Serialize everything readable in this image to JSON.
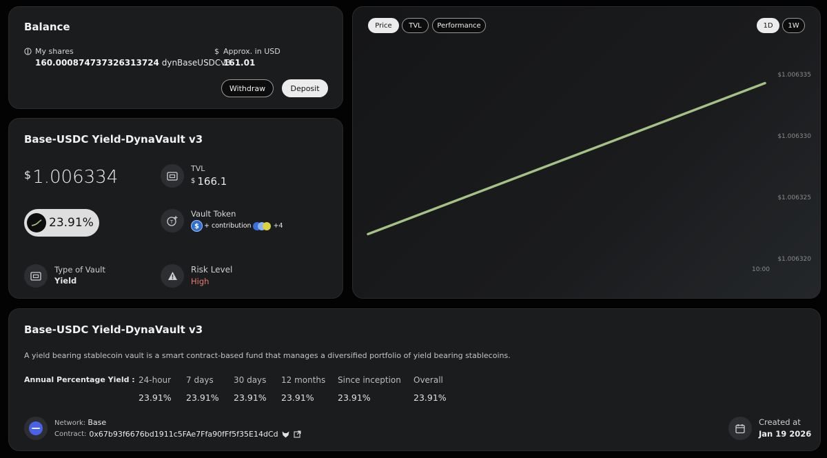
{
  "balance": {
    "title": "Balance",
    "shares_label": "My shares",
    "shares_value": "160.000874737326313724",
    "shares_token": "dynBaseUSDCv3",
    "usd_symbol": "$",
    "usd_label": "Approx. in USD",
    "usd_value": "161.01",
    "withdraw_label": "Withdraw",
    "deposit_label": "Deposit"
  },
  "vault": {
    "title": "Base-USDC Yield-DynaVault v3",
    "price_symbol": "$",
    "price_value": "1.006334",
    "apy_badge": "23.91%",
    "tvl_label": "TVL",
    "tvl_symbol": "$",
    "tvl_value": "166.1",
    "vault_token_label": "Vault Token",
    "vault_token_text": "+ contribution",
    "vault_token_more": "+4",
    "type_label": "Type of Vault",
    "type_value": "Yield",
    "risk_label": "Risk Level",
    "risk_value": "High"
  },
  "chart_tabs": {
    "price": "Price",
    "tvl": "TVL",
    "performance": "Performance",
    "range_1d": "1D",
    "range_1w": "1W"
  },
  "chart_data": {
    "type": "line",
    "x": [
      "",
      "10:00"
    ],
    "series": [
      {
        "values": [
          1.006322,
          1.0063343
        ]
      }
    ],
    "y_ticks": [
      "$1.006335",
      "$1.006330",
      "$1.006325",
      "$1.006320"
    ],
    "ylim": [
      1.00632,
      1.006335
    ],
    "x_tick": "10:00",
    "line_color": "#a4c283",
    "grid": false
  },
  "info": {
    "title": "Base-USDC Yield-DynaVault v3",
    "description": "A yield bearing stablecoin vault is a smart contract-based fund that manages a diversified portfolio of yield bearing stablecoins.",
    "apy_label": "Annual Percentage Yield :",
    "apy_columns": [
      {
        "period": "24-hour",
        "value": "23.91%"
      },
      {
        "period": "7 days",
        "value": "23.91%"
      },
      {
        "period": "30 days",
        "value": "23.91%"
      },
      {
        "period": "12 months",
        "value": "23.91%"
      },
      {
        "period": "Since inception",
        "value": "23.91%"
      },
      {
        "period": "Overall",
        "value": "23.91%"
      }
    ],
    "network_label": "Network:",
    "network_value": "Base",
    "contract_label": "Contract:",
    "contract_value": "0x67b93f6676bd1911c5FAe7Ffa90fFf5f35E14dCd",
    "created_label": "Created at",
    "created_value": "Jan 19 2026"
  },
  "colors": {
    "accent_line": "#a4c283",
    "risk_high": "#e37b6b",
    "network_blue": "#4a63e6"
  }
}
